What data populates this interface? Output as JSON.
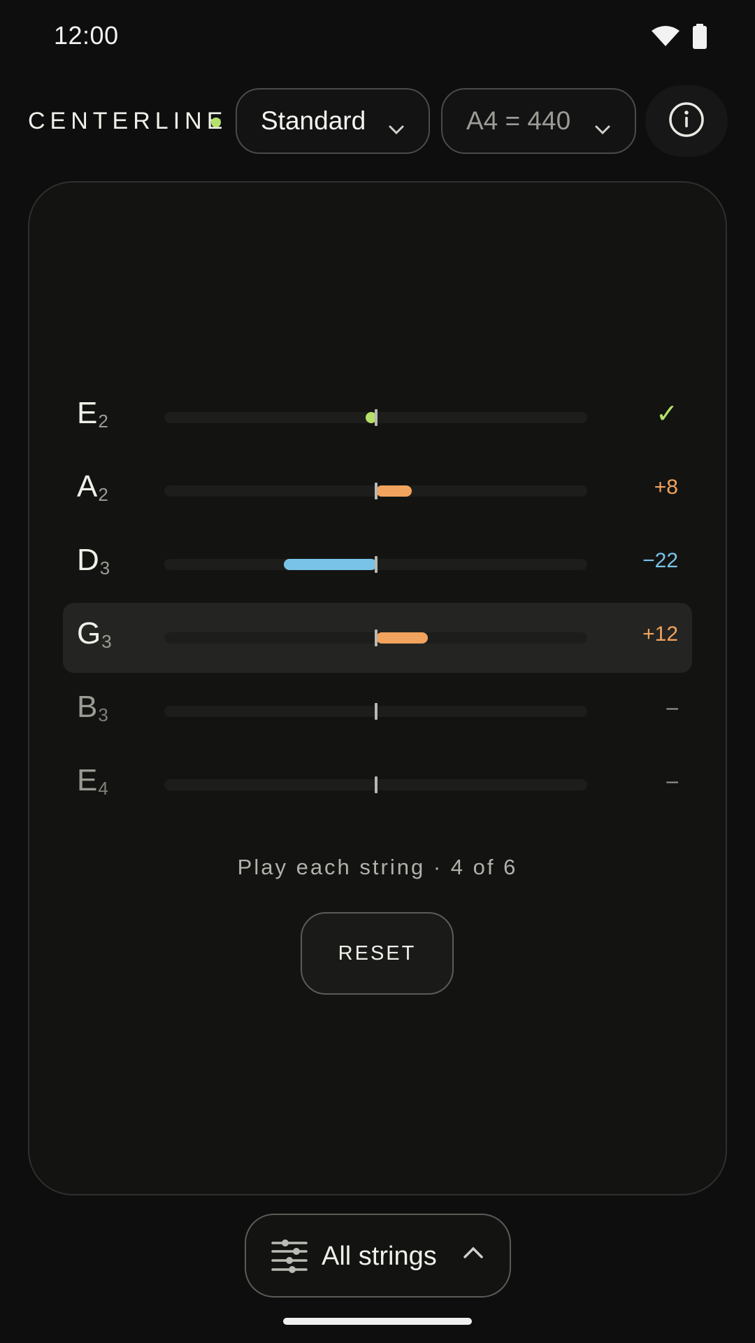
{
  "status_bar": {
    "time": "12:00",
    "icons": [
      "wifi-icon",
      "battery-icon"
    ]
  },
  "header": {
    "brand": "CENTERLINE",
    "tuning_label": "Standard",
    "reference_label": "A4 = 440",
    "info_icon": "info-icon"
  },
  "strings": [
    {
      "note": "E",
      "octave": "2",
      "state": "in-tune",
      "cents": 0,
      "readout": "✓"
    },
    {
      "note": "A",
      "octave": "2",
      "state": "sharp",
      "cents": 8,
      "readout": "+8"
    },
    {
      "note": "D",
      "octave": "3",
      "state": "flat",
      "cents": -22,
      "readout": "−22"
    },
    {
      "note": "G",
      "octave": "3",
      "state": "sharp",
      "cents": 12,
      "readout": "+12",
      "active": true
    },
    {
      "note": "B",
      "octave": "3",
      "state": "pending",
      "readout": "–"
    },
    {
      "note": "E",
      "octave": "4",
      "state": "pending",
      "readout": "–"
    }
  ],
  "prompt": "Play each string · 4 of 6",
  "reset_label": "RESET",
  "bottom": {
    "label": "All strings",
    "icon": "sliders-icon"
  },
  "colors": {
    "in_tune": "#b5e06a",
    "sharp": "#f2a35e",
    "flat": "#79c3e9",
    "pending": "#9a9c94"
  }
}
